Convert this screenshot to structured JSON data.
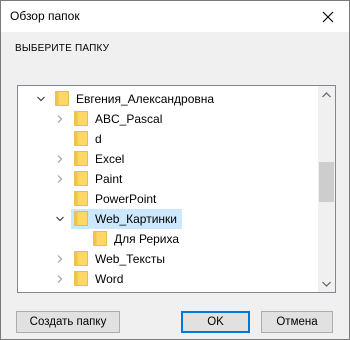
{
  "window": {
    "title": "Обзор папок",
    "close_icon": "close-icon"
  },
  "instruction": "ВЫБЕРИТЕ ПАПКУ",
  "tree": {
    "items": [
      {
        "label": "Евгения_Александровна",
        "level": 0,
        "expander": "expanded",
        "selected": false
      },
      {
        "label": "ABC_Pascal",
        "level": 1,
        "expander": "collapsed",
        "selected": false
      },
      {
        "label": "d",
        "level": 1,
        "expander": "none",
        "selected": false
      },
      {
        "label": "Excel",
        "level": 1,
        "expander": "collapsed",
        "selected": false
      },
      {
        "label": "Paint",
        "level": 1,
        "expander": "collapsed",
        "selected": false
      },
      {
        "label": "PowerPoint",
        "level": 1,
        "expander": "none",
        "selected": false
      },
      {
        "label": "Web_Картинки",
        "level": 1,
        "expander": "expanded",
        "selected": true
      },
      {
        "label": "Для Рериха",
        "level": 2,
        "expander": "none",
        "selected": false
      },
      {
        "label": "Web_Тексты",
        "level": 1,
        "expander": "collapsed",
        "selected": false
      },
      {
        "label": "Word",
        "level": 1,
        "expander": "collapsed",
        "selected": false
      }
    ],
    "folder_color": "#ffd766",
    "selection_color": "#cce8ff"
  },
  "buttons": {
    "new_folder": "Создать папку",
    "ok": "OK",
    "cancel": "Отмена"
  },
  "colors": {
    "accent": "#0078d7"
  }
}
